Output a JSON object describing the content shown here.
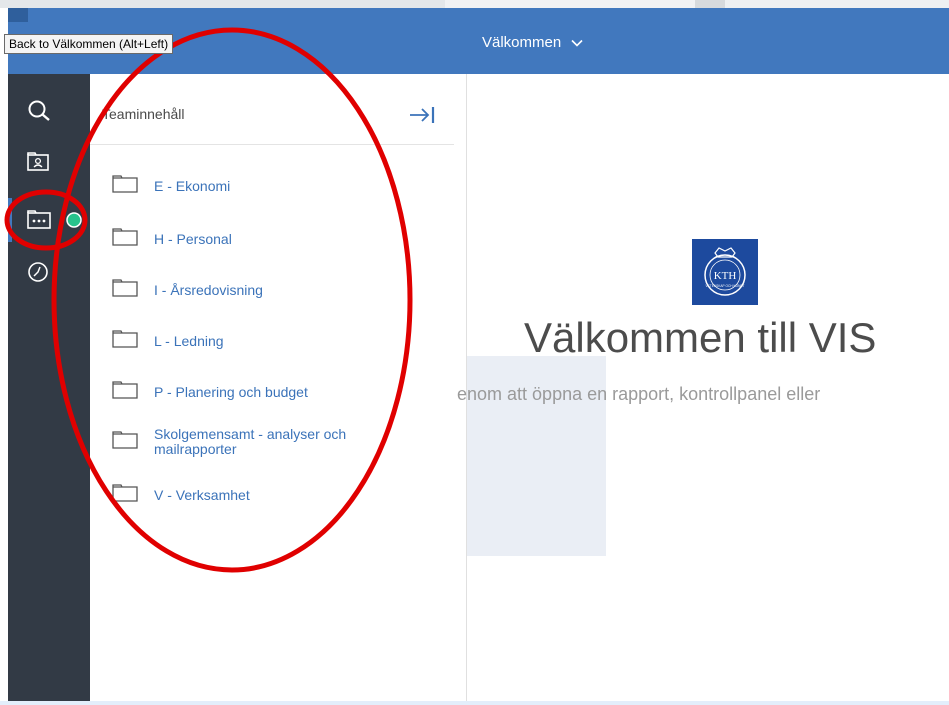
{
  "colors": {
    "header": "#4178be",
    "sidebar": "#323a45",
    "link": "#3b73b9",
    "annotation": "#e00000",
    "notification_dot": "#27c38c",
    "kth_blue": "#1d4a9e"
  },
  "tooltip": {
    "text": "Back to Välkommen (Alt+Left)"
  },
  "header": {
    "title": "Välkommen",
    "dropdown_icon": "chevron-down-icon"
  },
  "sidebar": {
    "items": [
      {
        "icon": "search-icon"
      },
      {
        "icon": "my-content-folder-icon"
      },
      {
        "icon": "team-content-folder-icon",
        "active": true
      },
      {
        "icon": "recent-clock-icon"
      }
    ]
  },
  "panel": {
    "title": "Teaminnehåll",
    "collapse_icon": "collapse-right-icon",
    "folders": [
      {
        "label": "E - Ekonomi"
      },
      {
        "label": "H - Personal"
      },
      {
        "label": "I - Årsredovisning"
      },
      {
        "label": "L - Ledning"
      },
      {
        "label": "P - Planering och budget"
      },
      {
        "label": "Skolgemensamt - analyser och mailrapporter"
      },
      {
        "label": "V - Verksamhet"
      }
    ]
  },
  "main": {
    "logo_text": "KTH",
    "logo_ring_text": "VETENSKAP OCH KONST",
    "welcome": "Välkommen till VIS",
    "subtitle": "enom att öppna en rapport, kontrollpanel eller"
  }
}
